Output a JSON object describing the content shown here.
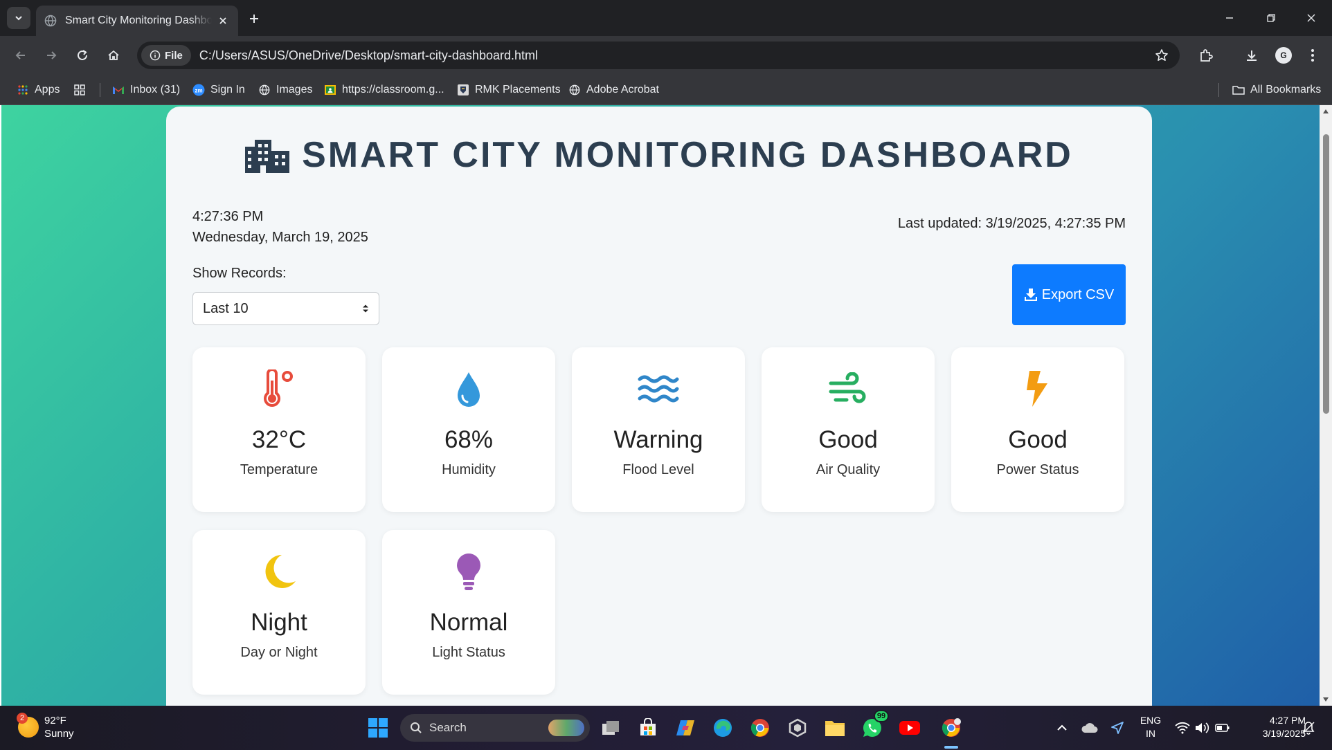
{
  "browser": {
    "tab_title": "Smart City Monitoring Dashboard",
    "site_chip": "File",
    "url": "C:/Users/ASUS/OneDrive/Desktop/smart-city-dashboard.html",
    "profile_initial": "G",
    "bookmarks": [
      {
        "label": "Apps",
        "icon": "apps-grid-icon"
      },
      {
        "label": "Inbox (31)",
        "icon": "gmail-icon"
      },
      {
        "label": "Sign In",
        "icon": "zoom-icon"
      },
      {
        "label": "Images",
        "icon": "globe-icon"
      },
      {
        "label": "https://classroom.g...",
        "icon": "classroom-icon"
      },
      {
        "label": "RMK Placements",
        "icon": "rmk-icon"
      },
      {
        "label": "Adobe Acrobat",
        "icon": "globe-icon"
      }
    ],
    "all_bookmarks": "All Bookmarks"
  },
  "dashboard": {
    "title": "SMART CITY MONITORING DASHBOARD",
    "time": "4:27:36 PM",
    "date": "Wednesday, March 19, 2025",
    "last_updated": "Last updated: 3/19/2025, 4:27:35 PM",
    "records_label": "Show Records:",
    "records_value": "Last 10",
    "export_label": "Export CSV",
    "cards": [
      {
        "value": "32°C",
        "label": "Temperature",
        "icon": "thermometer-icon",
        "color": "#e74c3c"
      },
      {
        "value": "68%",
        "label": "Humidity",
        "icon": "water-drop-icon",
        "color": "#3498db"
      },
      {
        "value": "Warning",
        "label": "Flood Level",
        "icon": "water-waves-icon",
        "color": "#2f86c9"
      },
      {
        "value": "Good",
        "label": "Air Quality",
        "icon": "wind-icon",
        "color": "#27ae60"
      },
      {
        "value": "Good",
        "label": "Power Status",
        "icon": "bolt-icon",
        "color": "#f39c12"
      },
      {
        "value": "Night",
        "label": "Day or Night",
        "icon": "moon-icon",
        "color": "#f1c40f"
      },
      {
        "value": "Normal",
        "label": "Light Status",
        "icon": "lightbulb-icon",
        "color": "#9b59b6"
      }
    ]
  },
  "taskbar": {
    "weather_temp": "92°F",
    "weather_desc": "Sunny",
    "weather_badge": "2",
    "search_placeholder": "Search",
    "whatsapp_badge": "99",
    "lang_line1": "ENG",
    "lang_line2": "IN",
    "clock_time": "4:27 PM",
    "clock_date": "3/19/2025"
  }
}
